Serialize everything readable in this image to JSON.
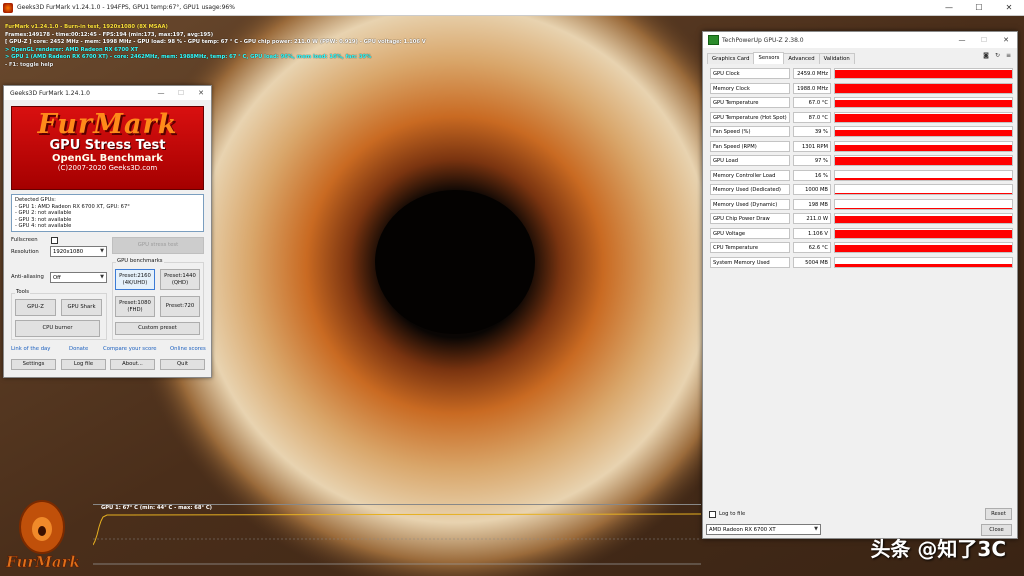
{
  "window": {
    "title": "Geeks3D FurMark v1.24.1.0 - 194FPS, GPU1 temp:67°, GPU1 usage:96%",
    "min": "—",
    "max": "☐",
    "close": "✕"
  },
  "osd": {
    "lines": [
      "FurMark v1.24.1.0 - Burn-in test, 1920x1080 (8X MSAA)",
      "Frames:149178 - time:00:12:45 - FPS:194 (min:173, max:197, avg:195)",
      "[ GPU-Z ] core: 2452 MHz - mem: 1998 MHz - GPU load: 98 % - GPU temp: 67 ° C - GPU chip power: 211.0 W (PPW: 0.919) - GPU voltage: 1.106 V",
      "> OpenGL renderer: AMD Radeon RX 6700 XT",
      "> GPU 1 (AMD Radeon RX 6700 XT) - core: 2462MHz, mem: 1988MHz, temp: 67 ° C, GPU load: 96%, mem load: 16%, fan: 39%",
      "- F1: toggle help"
    ]
  },
  "furmark": {
    "title": "Geeks3D FurMark 1.24.1.0",
    "banner": {
      "logo": "FurMark",
      "line2": "GPU Stress Test",
      "line3": "OpenGL Benchmark",
      "line4": "(C)2007-2020 Geeks3D.com"
    },
    "detected_title": "Detected GPUs:",
    "gpus": [
      "- GPU 1: AMD Radeon RX 6700 XT, GPU: 67°",
      "- GPU 2: not available",
      "- GPU 3: not available",
      "- GPU 4: not available"
    ],
    "fullscreen_label": "Fullscreen",
    "resolution_label": "Resolution",
    "resolution_value": "1920x1080",
    "antialiasing_label": "Anti-aliasing",
    "antialiasing_value": "Off",
    "stress_button": "GPU stress test",
    "benchmarks_label": "GPU benchmarks",
    "preset_2160": "Preset:2160\n(4K/UHD)",
    "preset_1440": "Preset:1440\n(QHD)",
    "preset_1080": "Preset:1080\n(FHD)",
    "preset_720": "Preset:720",
    "custom_preset": "Custom preset",
    "tools_label": "Tools",
    "gpuz_button": "GPU-Z",
    "gpushark_button": "GPU Shark",
    "cpuburner_button": "CPU burner",
    "link_of_day": "Link of the day",
    "donate": "Donate",
    "compare": "Compare your score",
    "online_scores": "Online scores",
    "settings": "Settings",
    "log_file": "Log file",
    "about": "About...",
    "quit": "Quit"
  },
  "gpuz": {
    "title": "TechPowerUp GPU-Z 2.38.0",
    "tabs": [
      "Graphics Card",
      "Sensors",
      "Advanced",
      "Validation"
    ],
    "active_tab": "Sensors",
    "sensors": [
      {
        "name": "GPU Clock",
        "value": "2459.0 MHz",
        "level": 0.85
      },
      {
        "name": "Memory Clock",
        "value": "1988.0 MHz",
        "level": 0.9
      },
      {
        "name": "GPU Temperature",
        "value": "67.0 °C",
        "level": 0.75
      },
      {
        "name": "GPU Temperature (Hot Spot)",
        "value": "87.0 °C",
        "level": 0.8
      },
      {
        "name": "Fan Speed (%)",
        "value": "39 %",
        "level": 0.7
      },
      {
        "name": "Fan Speed (RPM)",
        "value": "1301 RPM",
        "level": 0.65
      },
      {
        "name": "GPU Load",
        "value": "97 %",
        "level": 0.9
      },
      {
        "name": "Memory Controller Load",
        "value": "16 %",
        "level": 0.15
      },
      {
        "name": "Memory Used (Dedicated)",
        "value": "1000 MB",
        "level": 0.1
      },
      {
        "name": "Memory Used (Dynamic)",
        "value": "198 MB",
        "level": 0.1
      },
      {
        "name": "GPU Chip Power Draw",
        "value": "211.0 W",
        "level": 0.8
      },
      {
        "name": "GPU Voltage",
        "value": "1.106 V",
        "level": 0.8
      },
      {
        "name": "CPU Temperature",
        "value": "62.6 °C",
        "level": 0.75
      },
      {
        "name": "System Memory Used",
        "value": "5004 MB",
        "level": 0.25
      }
    ],
    "log_to_file": "Log to file",
    "reset": "Reset",
    "gpu_select": "AMD Radeon RX 6700 XT",
    "close": "Close"
  },
  "temp_graph": {
    "caption": "GPU 1: 67° C (min: 44° C - max: 68° C)"
  },
  "watermark": "头条 @知了3C",
  "furmark_logo_text": "FurMark",
  "colors": {
    "sensor_fill": "#ff0000",
    "osd_yellow": "#ffe23a",
    "osd_cyan": "#33ffff"
  }
}
